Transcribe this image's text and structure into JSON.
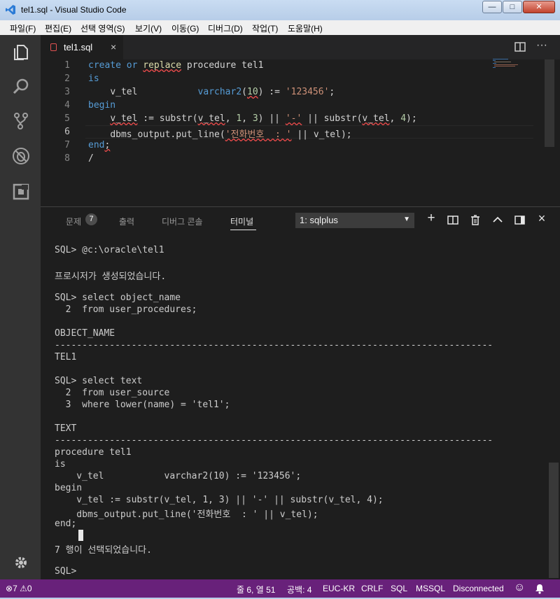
{
  "window": {
    "title": "tel1.sql - Visual Studio Code",
    "min_glyph": "—",
    "max_glyph": "□",
    "close_glyph": "✕"
  },
  "menu": [
    "파일(F)",
    "편집(E)",
    "선택 영역(S)",
    "보기(V)",
    "이동(G)",
    "디버그(D)",
    "작업(T)",
    "도움말(H)"
  ],
  "activity_icons": [
    "explorer-icon",
    "search-icon",
    "source-control-icon",
    "debug-icon",
    "extensions-icon",
    "settings-icon"
  ],
  "editor": {
    "tab_label": "tel1.sql",
    "tab_close": "×",
    "actions": [
      "split-editor-icon",
      "more-actions-icon"
    ],
    "more_glyph": "···",
    "current_line": 6,
    "line_numbers": [
      "1",
      "2",
      "3",
      "4",
      "5",
      "6",
      "7",
      "8"
    ]
  },
  "panel": {
    "tabs": [
      "문제",
      "출력",
      "디버그 콘솔",
      "터미널"
    ],
    "active_tab": "터미널",
    "problems_count": "7",
    "terminal_select": "1: sqlplus",
    "terminal_options": [
      "1: sqlplus"
    ],
    "icons": {
      "add": "+",
      "split": "◫",
      "trash": "🗑",
      "maximize": "∧",
      "toggle": "▣",
      "close": "×"
    },
    "terminal_lines": [
      "SQL> @c:\\oracle\\tel1",
      "",
      "프로시저가 생성되었습니다.",
      "",
      "SQL> select object_name",
      "  2  from user_procedures;",
      "",
      "OBJECT_NAME",
      "--------------------------------------------------------------------------------",
      "TEL1",
      "",
      "SQL> select text",
      "  2  from user_source",
      "  3  where lower(name) = 'tel1';",
      "",
      "TEXT",
      "--------------------------------------------------------------------------------",
      "procedure tel1",
      "is",
      "    v_tel           varchar2(10) := '123456';",
      "begin",
      "    v_tel := substr(v_tel, 1, 3) || '-' || substr(v_tel, 4);",
      "    dbms_output.put_line('전화번호  : ' || v_tel);",
      "end;",
      "",
      "7 행이 선택되었습니다.",
      "",
      "SQL> "
    ]
  },
  "status": {
    "errors": "7",
    "warnings": "0",
    "error_glyph": "⊗",
    "warning_glyph": "⚠",
    "position": "줄 6, 열 51",
    "spaces": "공백: 4",
    "encoding": "EUC-KR",
    "eol": "CRLF",
    "language": "SQL",
    "dialect": "MSSQL",
    "connection": "Disconnected",
    "feedback_glyph": "☺",
    "bell_glyph": "🔔"
  },
  "colors": {
    "status_bar": "#68217a",
    "activity_bar": "#333333",
    "editor_bg": "#1e1e1e",
    "keyword": "#569cd6",
    "string": "#ce9178",
    "function": "#dcdcaa",
    "number": "#b5cea8"
  }
}
